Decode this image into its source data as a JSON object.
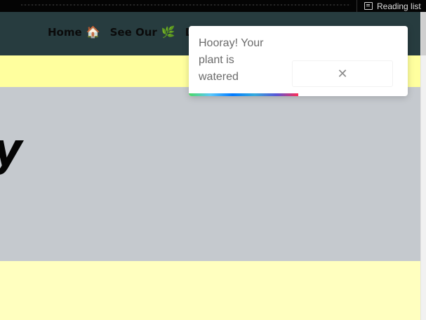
{
  "browser": {
    "reading_list_label": "Reading list"
  },
  "nav": {
    "items": [
      {
        "label": "Home",
        "emoji": "🏠",
        "icon": "house-icon"
      },
      {
        "label": "See Our",
        "emoji": "🌿",
        "icon": "leaf-icon"
      },
      {
        "label": "De",
        "emoji": "",
        "icon": ""
      }
    ]
  },
  "hero": {
    "glyph": "y"
  },
  "toast": {
    "message": "Hooray! Your plant is watered",
    "close_symbol": "✕",
    "progress_fraction": 0.5,
    "progress_colors": [
      "#4cd964",
      "#5ac8fa",
      "#007aff",
      "#34aadc",
      "#5856d6",
      "#ff2d55"
    ]
  },
  "colors": {
    "navbar": "#273c3f",
    "band_yellow": "#ffff9e",
    "hero_gray": "#c5c9ce",
    "bottom_yellow": "#ffffbf"
  }
}
